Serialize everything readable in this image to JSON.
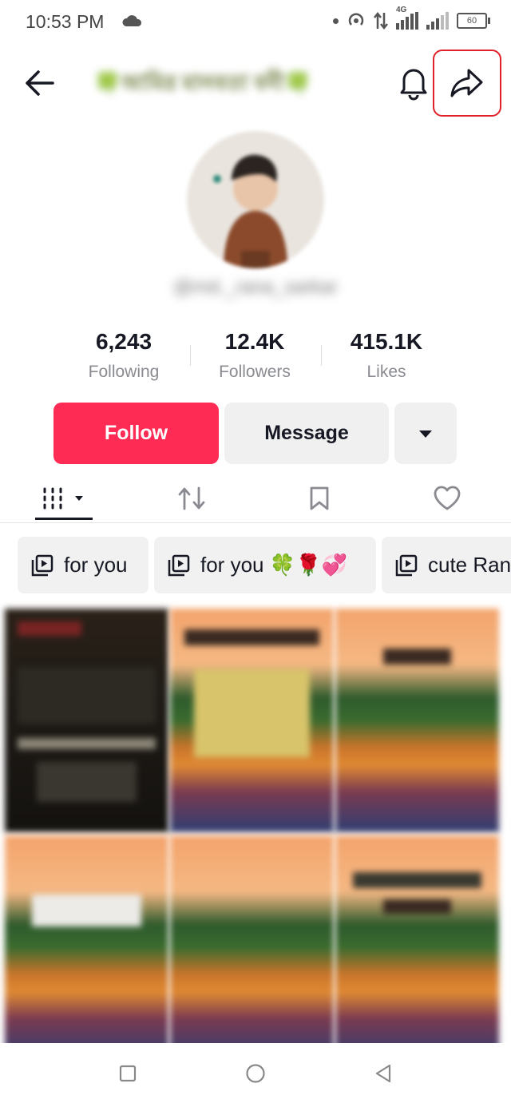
{
  "status_bar": {
    "time": "10:53 PM",
    "network": "4G",
    "battery": "60"
  },
  "header": {
    "title": "🍀আমির মানবতা বনী🍀"
  },
  "profile": {
    "username": "@md._rana_sarkar"
  },
  "stats": [
    {
      "value": "6,243",
      "label": "Following"
    },
    {
      "value": "12.4K",
      "label": "Followers"
    },
    {
      "value": "415.1K",
      "label": "Likes"
    }
  ],
  "actions": {
    "follow": "Follow",
    "message": "Message"
  },
  "playlists": [
    {
      "label": "for you"
    },
    {
      "label": "for you 🍀🌹💞"
    },
    {
      "label": "cute Ran"
    }
  ],
  "colors": {
    "accent": "#fe2c55",
    "highlight_box": "#e0202a"
  },
  "icons": [
    "back-arrow-icon",
    "bell-icon",
    "share-icon",
    "chevron-down-icon",
    "videos-grid-icon",
    "repost-icon",
    "bookmark-icon",
    "heart-icon",
    "playlist-icon",
    "nav-recents-icon",
    "nav-home-icon",
    "nav-back-icon"
  ]
}
